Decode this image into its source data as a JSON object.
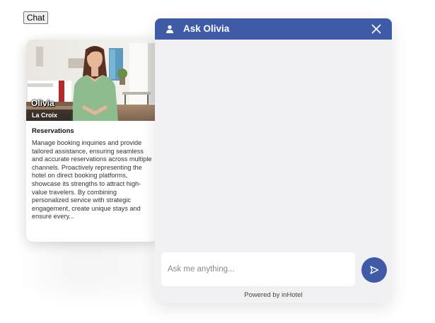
{
  "chat_toggle": {
    "label": "Chat"
  },
  "agent": {
    "name": "Olivia",
    "hotel": "La Croix",
    "role": "Reservations",
    "description": "Manage booking inquiries and provide tailored assistance, ensuring seamless and accurate reservations across multiple channels. Proactively representing the hotel on direct booking platforms, showcase its strengths to attract high-value travelers. By combining personalized service with strategic engagement, create unique stays and ensure every..."
  },
  "chat": {
    "title": "Ask Olivia",
    "input_placeholder": "Ask me anything...",
    "input_value": "",
    "powered_by": "Powered by inHotel"
  },
  "icons": {
    "header": "user-icon",
    "close": "close-icon",
    "send": "send-icon"
  },
  "colors": {
    "accent": "#3f5aa6",
    "panel_background": "#f1f1f3"
  }
}
